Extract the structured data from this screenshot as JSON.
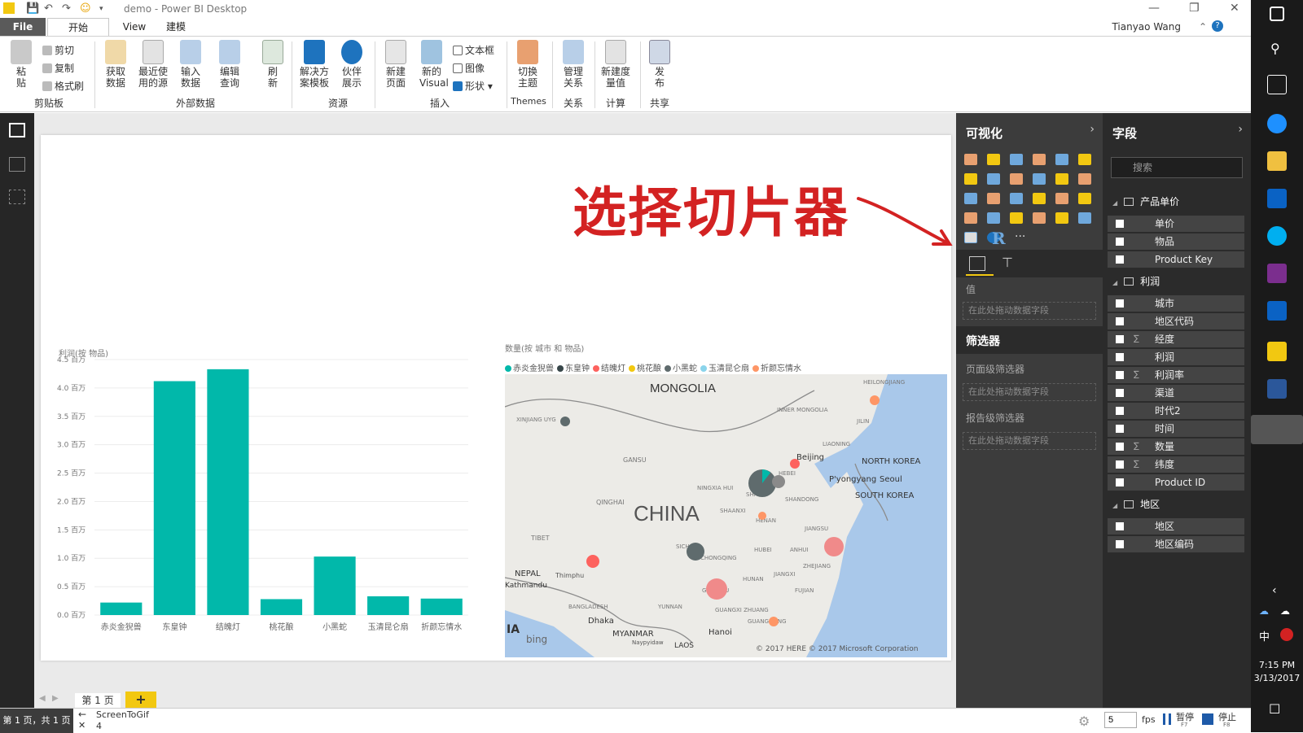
{
  "window": {
    "title": "demo - Power BI Desktop",
    "user": "Tianyao Wang"
  },
  "ribbon_tabs": [
    "File",
    "开始",
    "View",
    "建模"
  ],
  "ribbon": {
    "clipboard": {
      "paste": "粘贴",
      "cut": "剪切",
      "copy": "复制",
      "format_painter": "格式刷",
      "group": "剪贴板"
    },
    "external": {
      "get_data": "获取数据",
      "recent": "最近使用的源",
      "enter_data": "输入数据",
      "edit_queries": "编辑查询",
      "refresh": "刷新",
      "group": "外部数据"
    },
    "resources": {
      "solution": "解决方案模板",
      "partner": "伙伴展示",
      "group": "资源"
    },
    "insert": {
      "new_page": "新建页面",
      "new_visual": "新的Visual",
      "textbox": "文本框",
      "image": "图像",
      "shapes": "形状",
      "group": "插入"
    },
    "themes": {
      "switch": "切换主题",
      "group": "Themes"
    },
    "relations": {
      "manage": "管理关系",
      "group": "关系"
    },
    "calc": {
      "new_measure": "新建度量值",
      "group": "计算"
    },
    "share": {
      "publish": "发布",
      "group": "共享"
    }
  },
  "annotation": "选择切片器",
  "chart_data": [
    {
      "type": "bar",
      "title": "利润(按 物品)",
      "categories": [
        "赤炎金猊兽",
        "东皇钟",
        "结魄灯",
        "桃花酿",
        "小黑蛇",
        "玉清昆仑扇",
        "折颜忘情水"
      ],
      "values": [
        0.22,
        4.12,
        4.33,
        0.28,
        1.03,
        0.33,
        0.29
      ],
      "y_ticks": [
        "0.0 百万",
        "0.5 百万",
        "1.0 百万",
        "1.5 百万",
        "2.0 百万",
        "2.5 百万",
        "3.0 百万",
        "3.5 百万",
        "4.0 百万",
        "4.5 百万"
      ],
      "ylim": [
        0,
        4.5
      ],
      "color": "#01b8aa"
    }
  ],
  "map": {
    "title": "数量(按 城市 和 物品)",
    "legend": [
      {
        "name": "赤炎金猊兽",
        "color": "#01b8aa"
      },
      {
        "name": "东皇钟",
        "color": "#374649"
      },
      {
        "name": "结魄灯",
        "color": "#fd625e"
      },
      {
        "name": "桃花酿",
        "color": "#f2c80f"
      },
      {
        "name": "小黑蛇",
        "color": "#5f6b6d"
      },
      {
        "name": "玉清昆仑扇",
        "color": "#8ad4eb"
      },
      {
        "name": "折颜忘情水",
        "color": "#fe9666"
      }
    ],
    "labels": {
      "mongolia": "MONGOLIA",
      "china": "CHINA",
      "beijing": "Beijing",
      "north_korea": "NORTH KOREA",
      "pyongyang": "P'yongyang",
      "seoul": "Seoul",
      "south_korea": "SOUTH KOREA",
      "gansu": "GANSU",
      "qinghai": "QINGHAI",
      "tibet": "TIBET",
      "nepal": "NEPAL",
      "kathmandu": "Kathmandu",
      "myanmar": "MYANMAR",
      "laos": "LAOS",
      "hanoi": "Hanoi",
      "dhaka": "Dhaka",
      "bangladesh": "BANGLADESH",
      "heilongjiang": "HEILONGJIANG",
      "jilin": "JILIN",
      "liaoning": "LIAONING",
      "inner_mongolia": "INNER MONGOLIA",
      "xinjiang": "XINJIANG UYG",
      "ningxia": "NINGXIA HUI",
      "shanxi": "SHANXI",
      "shaanxi": "SHAANXI",
      "hebei": "HEBEI",
      "shandong": "SHANDONG",
      "henan": "HENAN",
      "jiangsu": "JIANGSU",
      "anhui": "ANHUI",
      "hubei": "HUBEI",
      "sichuan": "SICH",
      "chongqing": "CHONGQING",
      "zhejiang": "ZHEJIANG",
      "hunan": "HUNAN",
      "jiangxi": "JIANGXI",
      "fujian": "FUJIAN",
      "guizhou": "GUIZHOU",
      "guangxi": "GUANGXI ZHUANG",
      "guangdong": "GUANGDONG",
      "yunnan": "YUNNAN",
      "thimphu": "Thimphu",
      "naypyidaw": "Naypyidaw",
      "ia": "IA",
      "bing": "bing",
      "copyright": "© 2017 HERE   © 2017 Microsoft Corporation"
    }
  },
  "viz_pane": {
    "title": "可视化",
    "values_label": "值",
    "drop_hint": "在此处拖动数据字段",
    "filters_title": "筛选器",
    "page_filters": "页面级筛选器",
    "report_filters": "报告级筛选器",
    "r_label": "R",
    "more": "···"
  },
  "fields_pane": {
    "title": "字段",
    "search_placeholder": "搜索",
    "tables": [
      {
        "name": "产品单价",
        "fields": [
          "单价",
          "物品",
          "Product Key"
        ]
      },
      {
        "name": "利润",
        "fields": [
          "城市",
          "地区代码",
          "经度",
          "利润",
          "利润率",
          "渠道",
          "时代2",
          "时间",
          "数量",
          "纬度",
          "Product ID"
        ]
      },
      {
        "name": "地区",
        "fields": [
          "地区",
          "地区编码"
        ]
      }
    ]
  },
  "page_tabs": {
    "page1": "第 1 页",
    "add": "+"
  },
  "status": {
    "page_info": "第 1 页，共 1 页",
    "screentogif": "ScreenToGif",
    "count": "4",
    "fps_value": "5",
    "fps": "fps",
    "pause": "暂停",
    "pause_key": "F7",
    "stop": "停止",
    "stop_key": "F8"
  },
  "taskbar": {
    "time": "7:15 PM",
    "date": "3/13/2017",
    "ime": "中"
  }
}
